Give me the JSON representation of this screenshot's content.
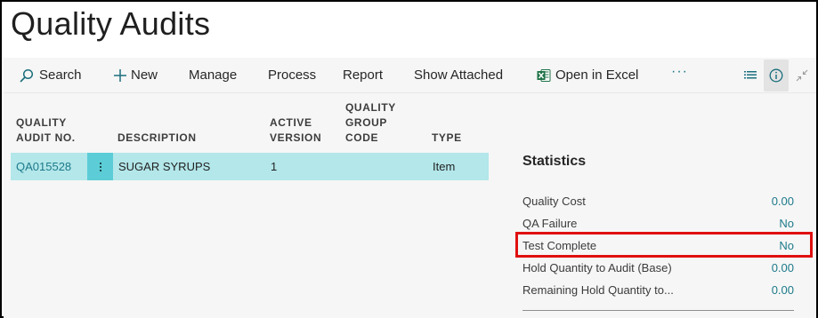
{
  "page": {
    "title": "Quality Audits"
  },
  "toolbar": {
    "search": "Search",
    "new": "New",
    "manage": "Manage",
    "process": "Process",
    "report": "Report",
    "show_attached": "Show Attached",
    "open_in_excel": "Open in Excel",
    "more": "···",
    "icons": {
      "search": "search-icon",
      "new": "plus-icon",
      "excel": "excel-icon",
      "list_view": "list-view-icon",
      "info": "info-icon",
      "collapse": "collapse-icon"
    }
  },
  "table": {
    "columns": {
      "audit_no_line1": "QUALITY",
      "audit_no_line2": "AUDIT NO.",
      "description": "DESCRIPTION",
      "active_version_line1": "ACTIVE",
      "active_version_line2": "VERSION",
      "group_code_line1": "QUALITY",
      "group_code_line2": "GROUP",
      "group_code_line3": "CODE",
      "type": "TYPE"
    },
    "rows": [
      {
        "audit_no": "QA015528",
        "description": "SUGAR SYRUPS",
        "active_version": "1",
        "group_code": "",
        "type": "Item"
      }
    ]
  },
  "factbox": {
    "title": "Statistics",
    "fields": [
      {
        "label": "Quality Cost",
        "value": "0.00"
      },
      {
        "label": "QA Failure",
        "value": "No"
      },
      {
        "label": "Test Complete",
        "value": "No"
      },
      {
        "label": "Hold Quantity to Audit (Base)",
        "value": "0.00"
      },
      {
        "label": "Remaining Hold Quantity to...",
        "value": "0.00"
      }
    ]
  },
  "colors": {
    "accent": "#1d7a8a",
    "selected_row": "#b3e7ea",
    "row_menu": "#5ccdd6",
    "highlight": "#e01010",
    "excel_green": "#1e7145"
  }
}
